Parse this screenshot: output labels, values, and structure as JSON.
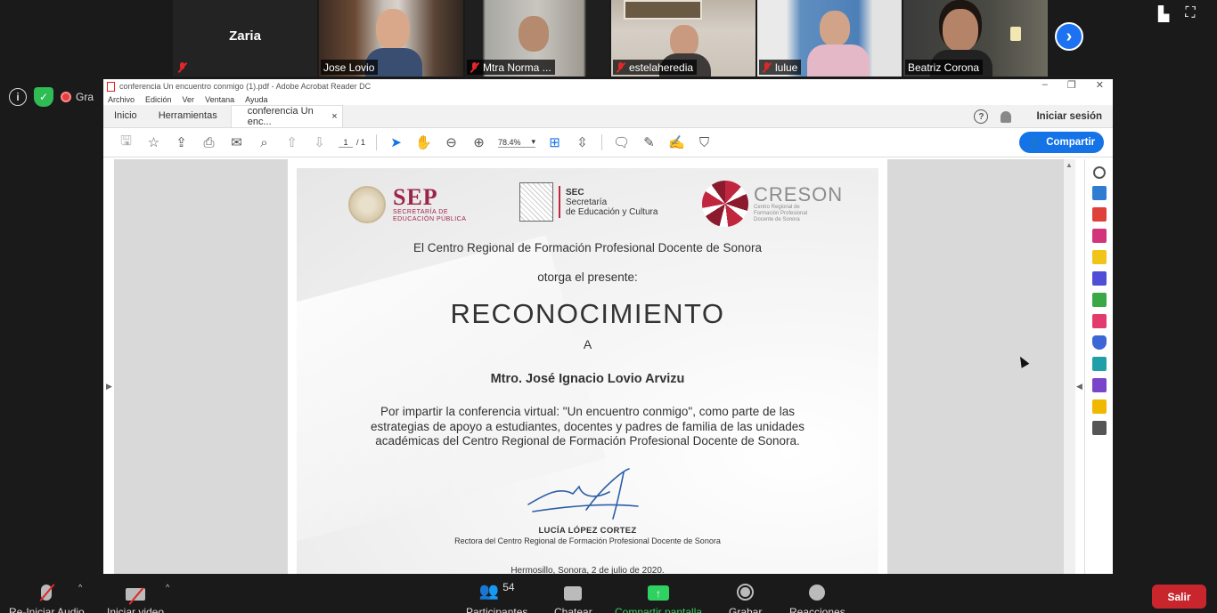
{
  "zoom": {
    "participants": [
      {
        "name": "Zaria",
        "video": false,
        "muted": true
      },
      {
        "name": "Jose Lovio",
        "video": true,
        "muted": false
      },
      {
        "name": "Mtra Norma ...",
        "video": true,
        "muted": true
      },
      {
        "name": "estelaheredia",
        "video": true,
        "muted": true
      },
      {
        "name": "lulue",
        "video": true,
        "muted": true
      },
      {
        "name": "Beatriz Corona",
        "video": true,
        "muted": false,
        "active_speaker": true
      }
    ],
    "recording_label": "Gra",
    "toolbar": {
      "audio_label": "Re-Iniciar Audio",
      "video_label": "Iniciar video",
      "participants_label": "Participantes",
      "participants_count": "54",
      "chat_label": "Chatear",
      "share_label": "Compartir pantalla",
      "record_label": "Grabar",
      "reactions_label": "Reacciones",
      "leave_label": "Salir"
    },
    "colors": {
      "active_speaker": "#a5d22a",
      "share": "#2fd160",
      "leave": "#c9252d",
      "muted": "#e02828",
      "next": "#1d72f2"
    }
  },
  "acrobat": {
    "window_title": "conferencia Un encuentro conmigo (1).pdf - Adobe Acrobat Reader DC",
    "menu": [
      "Archivo",
      "Edición",
      "Ver",
      "Ventana",
      "Ayuda"
    ],
    "tabs": {
      "home": "Inicio",
      "tools": "Herramientas",
      "document": "conferencia Un enc..."
    },
    "signin_label": "Iniciar sesión",
    "share_button": "Compartir",
    "page_current": "1",
    "page_total": "/ 1",
    "zoom": "78.4%",
    "accent": "#1473e6"
  },
  "certificate": {
    "sep_logo": "SEP",
    "sep_subtitle": "SECRETARÍA DE EDUCACIÓN PÚBLICA",
    "sec_logo": "SEC",
    "sec_line1": "Secretaría",
    "sec_line2": "de Educación y Cultura",
    "creson_logo": "CRESON",
    "creson_subtitle": "Centro Regional de Formación Profesional Docente de Sonora",
    "issuer": "El Centro Regional de Formación Profesional Docente de Sonora",
    "grants": "otorga el presente:",
    "title": "RECONOCIMIENTO",
    "to": "A",
    "recipient": "Mtro. José Ignacio Lovio Arvizu",
    "body": "Por impartir la conferencia virtual: \"Un encuentro conmigo\", como parte de las estrategias de apoyo a estudiantes, docentes y padres de familia de las unidades académicas del Centro Regional de Formación Profesional Docente de Sonora.",
    "signer": "LUCÍA LÓPEZ CORTEZ",
    "signer_role": "Rectora del Centro Regional de Formación Profesional Docente de Sonora",
    "place_date": "Hermosillo, Sonora, 2 de julio de 2020."
  }
}
